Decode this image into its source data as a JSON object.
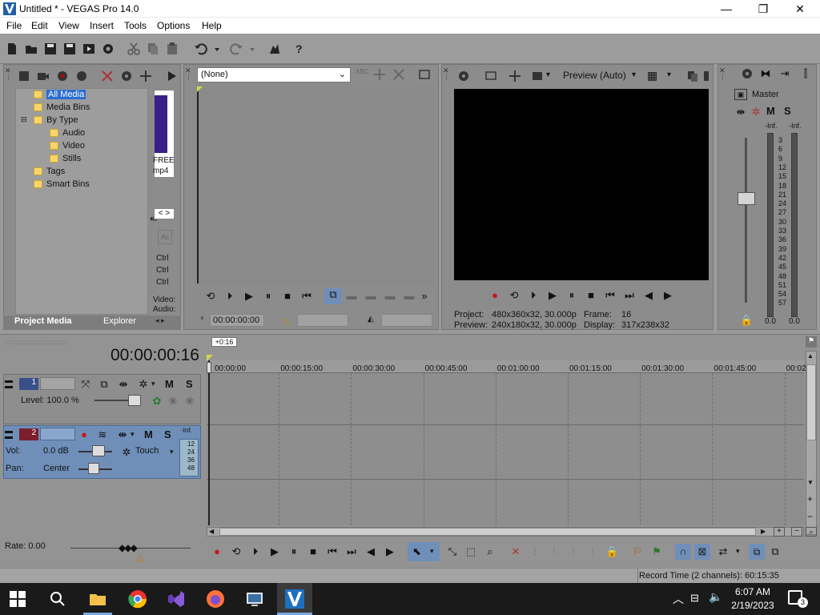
{
  "window": {
    "title": "Untitled * - VEGAS Pro 14.0",
    "min_glyph": "—",
    "max_glyph": "❐",
    "close_glyph": "✕"
  },
  "menu": {
    "file": "File",
    "edit": "Edit",
    "view": "View",
    "insert": "Insert",
    "tools": "Tools",
    "options": "Options",
    "help": "Help"
  },
  "project_media": {
    "tree": [
      "All Media",
      "Media Bins",
      "By Type",
      "Audio",
      "Video",
      "Stills",
      "Tags",
      "Smart Bins"
    ],
    "thumb_caption_1": "FREE",
    "thumb_caption_2": "mp4",
    "ctrl1": "Ctrl",
    "ctrl2": "Ctrl",
    "ctrl3": "Ctrl",
    "video_label": "Video:",
    "audio_label": "Audio:",
    "tabs": {
      "project_media": "Project Media",
      "explorer": "Explorer"
    },
    "thumb_nav": "< >"
  },
  "trimmer": {
    "dropdown_value": "(None)",
    "timecode": "00:00:00:00"
  },
  "preview": {
    "quality": "Preview (Auto)",
    "project_label": "Project:",
    "project_value": "480x360x32, 30.000p",
    "preview_label": "Preview:",
    "preview_value": "240x180x32, 30.000p",
    "frame_label": "Frame:",
    "frame_value": "16",
    "display_label": "Display:",
    "display_value": "317x238x32"
  },
  "mixer": {
    "master": "Master",
    "m": "M",
    "s": "S",
    "inf_l": "-Inf.",
    "inf_r": "-Inf.",
    "scale": [
      "3",
      "6",
      "9",
      "12",
      "15",
      "18",
      "21",
      "24",
      "27",
      "30",
      "33",
      "36",
      "39",
      "42",
      "45",
      "48",
      "51",
      "54",
      "57"
    ],
    "val_l": "0.0",
    "val_r": "0.0"
  },
  "timeline": {
    "current_time": "00:00:00:16",
    "cursor_flag": "+0:16",
    "ruler": [
      "00:00:00",
      "00:00:15:00",
      "00:00:30:00",
      "00:00:45:00",
      "00:01:00:00",
      "00:01:15:00",
      "00:01:30:00",
      "00:01:45:00",
      "00:02"
    ],
    "tracks": [
      {
        "num": "1",
        "type": "video",
        "level_label": "Level: 100.0 %",
        "m": "M",
        "s": "S"
      },
      {
        "num": "2",
        "type": "audio",
        "vol_label": "Vol:",
        "vol_value": "0.0 dB",
        "pan_label": "Pan:",
        "pan_value": "Center",
        "touch": "Touch",
        "m": "M",
        "s": "S",
        "meter_inf": "-Inf.",
        "meter_scale": [
          "12",
          "24",
          "36",
          "48"
        ]
      }
    ],
    "rate": "Rate: 0.00"
  },
  "status": {
    "record_time": "Record Time (2 channels): 60:15:35"
  },
  "taskbar": {
    "time": "6:07 AM",
    "date": "2/19/2023",
    "notif_count": "3"
  },
  "colors": {
    "accent": "#2b6dd1",
    "panel": "#8c8c8c",
    "track_selected": "#6f8fb9"
  }
}
